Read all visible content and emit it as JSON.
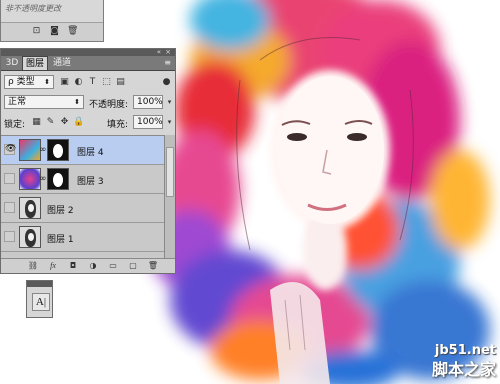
{
  "top_panel": {
    "hint": "非不透明度更改"
  },
  "layers_panel": {
    "tabs": [
      "3D",
      "图层",
      "通道"
    ],
    "active_tab": "图层",
    "filter_kind": "ρ 类型",
    "blend_mode": "正常",
    "opacity_label": "不透明度:",
    "opacity_value": "100%",
    "lock_label": "锁定:",
    "fill_label": "填充:",
    "fill_value": "100%",
    "layers": [
      {
        "name": "图层 4",
        "selected": true,
        "visible": true,
        "has_mask": true
      },
      {
        "name": "图层 3",
        "selected": false,
        "visible": false,
        "has_mask": true
      },
      {
        "name": "图层 2",
        "selected": false,
        "visible": false,
        "has_mask": false
      },
      {
        "name": "图层 1",
        "selected": false,
        "visible": false,
        "has_mask": false
      }
    ],
    "bottom_icons": [
      "link-icon",
      "fx-icon",
      "mask-icon",
      "adjustment-icon",
      "group-icon",
      "new-layer-icon",
      "trash-icon"
    ]
  },
  "char_panel": {
    "glyph": "A|"
  },
  "watermark": {
    "site": "jb51.net",
    "brand": "脚本之家"
  }
}
